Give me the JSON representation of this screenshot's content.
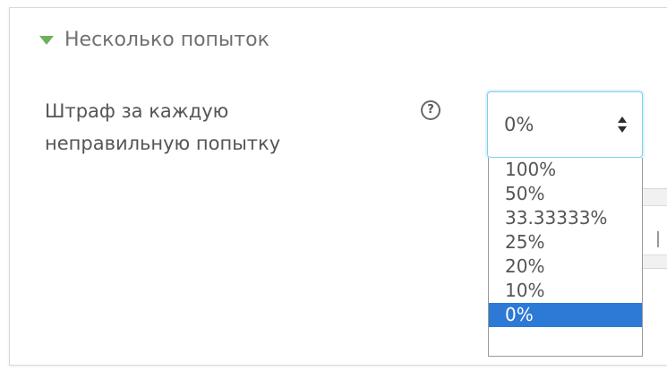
{
  "section": {
    "title": "Несколько попыток"
  },
  "field": {
    "label": "Штраф за каждую неправильную попытку",
    "help_icon": "question-circle-icon"
  },
  "select": {
    "selected_value": "0%",
    "arrow_icon": "updown-arrows-icon",
    "options": [
      "100%",
      "50%",
      "33.33333%",
      "25%",
      "20%",
      "10%",
      "0%"
    ],
    "highlighted_index": 6
  },
  "colors": {
    "triangle": "#6fb05f",
    "selection": "#2d79d6",
    "focus_border": "#7fd0f0",
    "text": "#555555"
  }
}
